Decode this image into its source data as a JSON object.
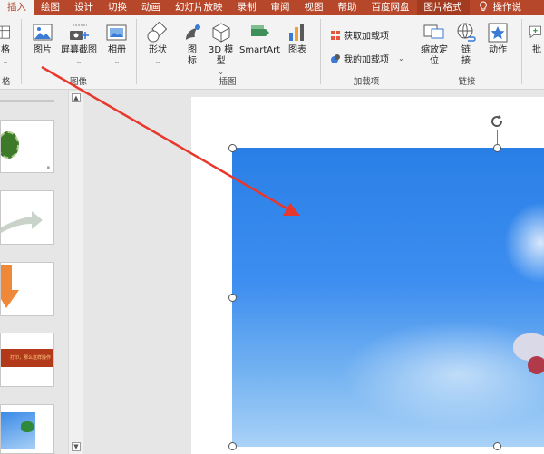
{
  "tabs": [
    {
      "label": "插入",
      "active": true
    },
    {
      "label": "绘图"
    },
    {
      "label": "设计"
    },
    {
      "label": "切换"
    },
    {
      "label": "动画"
    },
    {
      "label": "幻灯片放映"
    },
    {
      "label": "录制"
    },
    {
      "label": "审阅"
    },
    {
      "label": "视图"
    },
    {
      "label": "帮助"
    },
    {
      "label": "百度网盘"
    },
    {
      "label": "图片格式"
    },
    {
      "label": "操作说"
    }
  ],
  "ribbon": {
    "table_group": {
      "btn_label": "格",
      "group_label": "格"
    },
    "image_group": {
      "picture_label": "图片",
      "screenshot_label": "屏幕截图",
      "album_label": "相册",
      "group_label": "图像"
    },
    "illustration_group": {
      "shapes_label": "形状",
      "icons_label_1": "图",
      "icons_label_2": "标",
      "model3d_label_1": "3D 模",
      "model3d_label_2": "型",
      "smartart_label": "SmartArt",
      "chart_label": "图表",
      "group_label": "插图"
    },
    "addin_group": {
      "get_addins_label": "获取加载项",
      "my_addins_label": "我的加载项",
      "group_label": "加载项"
    },
    "link_group": {
      "zoom_label_1": "缩放定",
      "zoom_label_2": "位",
      "link_label_1": "链",
      "link_label_2": "接",
      "action_label": "动作",
      "group_label": "链接"
    },
    "comment_group": {
      "label": "批"
    }
  },
  "thumbnails": [
    {
      "kind": "green-circle"
    },
    {
      "kind": "gray-arrow"
    },
    {
      "kind": "orange-arrow"
    },
    {
      "kind": "text-banner",
      "text": "打印，那么这样操作"
    },
    {
      "kind": "image"
    }
  ],
  "colors": {
    "accent": "#b7472a",
    "ribbon_bg": "#f3f3f3",
    "arrow": "#e8372c"
  }
}
